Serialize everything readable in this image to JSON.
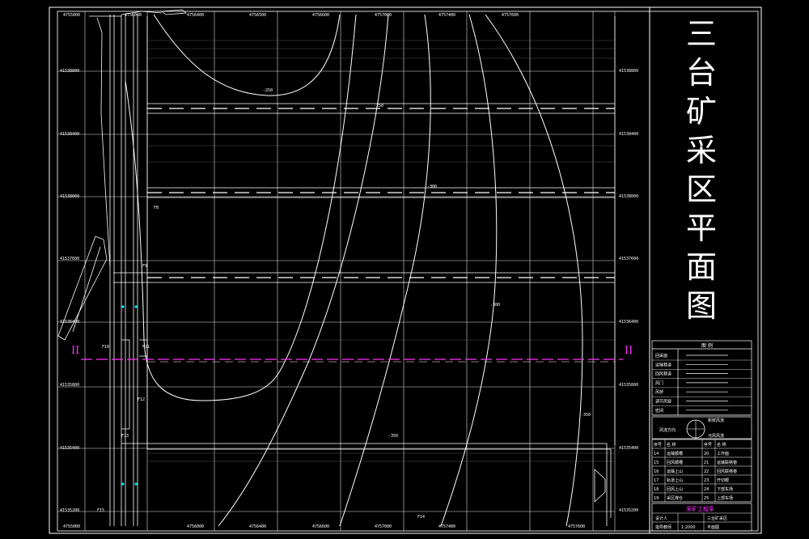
{
  "title_chars": [
    "三",
    "台",
    "矿",
    "采",
    "区",
    "平",
    "面",
    "图"
  ],
  "section_mark": "II",
  "top_coords": [
    "4755000",
    "4756000",
    "4756400",
    "4756500",
    "4756600",
    "4757000",
    "4757400",
    "4757600"
  ],
  "bottom_coords": [
    "4755000",
    "4756000",
    "4756400",
    "4756600",
    "4757000",
    "4757400",
    "4757600"
  ],
  "left_coords": [
    "41538800",
    "41538400",
    "41538000",
    "41537600",
    "41536400",
    "41535800",
    "41535400",
    "41535200"
  ],
  "right_coords": [
    "41538800",
    "41538400",
    "41538000",
    "41537600",
    "41536400",
    "41535800",
    "41535400",
    "41535200"
  ],
  "contour_labels": [
    "-250",
    "-250",
    "-300",
    "-300",
    "-350",
    "-350"
  ],
  "point_labels": [
    "F8",
    "F9",
    "F10",
    "F11",
    "F12",
    "F13",
    "F14",
    "F15"
  ],
  "legend": {
    "heading": "图 例",
    "rows": [
      "回采面",
      "运输巷道",
      "回风巷道",
      "风门",
      "风桥",
      "调节风窗",
      "密闭"
    ]
  },
  "north": {
    "label1": "风流方向",
    "label2": "新鲜风流",
    "label3": "污风风流"
  },
  "table": {
    "headers": [
      "序号",
      "名 称",
      "序号",
      "名 称"
    ],
    "rows": [
      [
        "14",
        "运输顺槽",
        "20",
        "工作面"
      ],
      [
        "15",
        "回风顺槽",
        "21",
        "运输联络巷"
      ],
      [
        "16",
        "运输上山",
        "22",
        "回风联络巷"
      ],
      [
        "17",
        "轨道上山",
        "23",
        "开切眼"
      ],
      [
        "18",
        "回风上山",
        "24",
        "下部车场"
      ],
      [
        "19",
        "采区煤仓",
        "25",
        "上部车场"
      ]
    ]
  },
  "footer": {
    "company": "采矿工程系",
    "row1": [
      "设计人",
      "三台矿采区"
    ],
    "row2": [
      "指导教师",
      "平面图"
    ],
    "row3": [
      "比例",
      "1:2000",
      "图号"
    ]
  }
}
